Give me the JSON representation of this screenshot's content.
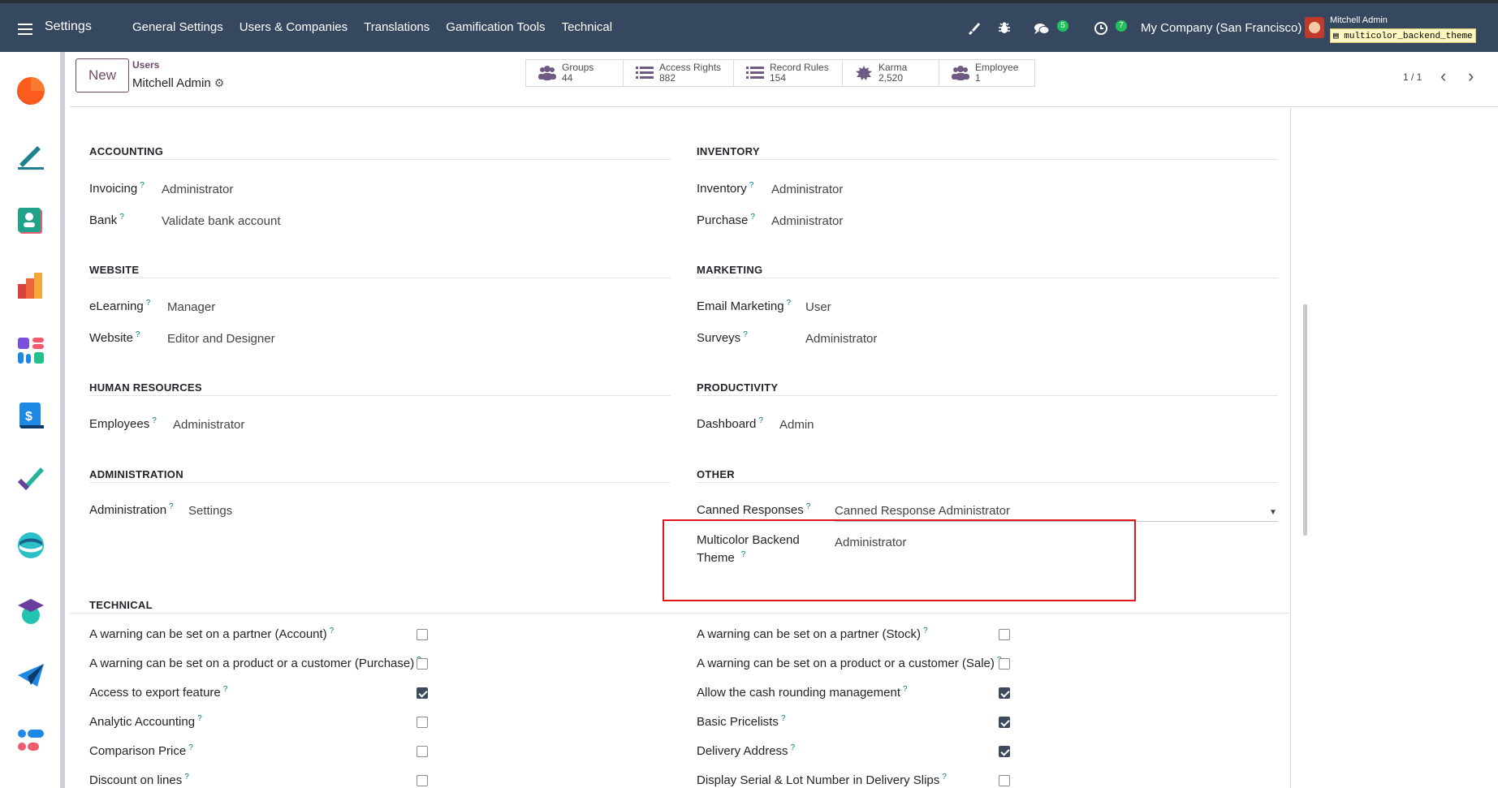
{
  "nav": {
    "app_name": "Settings",
    "menu": [
      "General Settings",
      "Users & Companies",
      "Translations",
      "Gamification Tools",
      "Technical"
    ],
    "messages_badge": "5",
    "activities_badge": "7",
    "company": "My Company (San Francisco)",
    "user_name": "Mitchell Admin",
    "db_name": "multicolor_backend_theme"
  },
  "control": {
    "new_label": "New",
    "breadcrumb_parent": "Users",
    "breadcrumb_current": "Mitchell Admin",
    "stats": [
      {
        "label": "Groups",
        "value": "44",
        "icon": "users-icon"
      },
      {
        "label": "Access Rights",
        "value": "882",
        "icon": "list-icon"
      },
      {
        "label": "Record Rules",
        "value": "154",
        "icon": "list-icon"
      },
      {
        "label": "Karma",
        "value": "2,520",
        "icon": "gear-badge-icon"
      },
      {
        "label": "Employee",
        "value": "1",
        "icon": "users-icon"
      }
    ],
    "pager": "1 / 1"
  },
  "sections": {
    "accounting": {
      "title": "ACCOUNTING",
      "fields": [
        {
          "label": "Invoicing",
          "value": "Administrator"
        },
        {
          "label": "Bank",
          "value": "Validate bank account"
        }
      ]
    },
    "inventory": {
      "title": "INVENTORY",
      "fields": [
        {
          "label": "Inventory",
          "value": "Administrator"
        },
        {
          "label": "Purchase",
          "value": "Administrator"
        }
      ]
    },
    "website": {
      "title": "WEBSITE",
      "fields": [
        {
          "label": "eLearning",
          "value": "Manager"
        },
        {
          "label": "Website",
          "value": "Editor and Designer"
        }
      ]
    },
    "marketing": {
      "title": "MARKETING",
      "fields": [
        {
          "label": "Email Marketing",
          "value": "User"
        },
        {
          "label": "Surveys",
          "value": "Administrator"
        }
      ]
    },
    "hr": {
      "title": "HUMAN RESOURCES",
      "fields": [
        {
          "label": "Employees",
          "value": "Administrator"
        }
      ]
    },
    "productivity": {
      "title": "PRODUCTIVITY",
      "fields": [
        {
          "label": "Dashboard",
          "value": "Admin"
        }
      ]
    },
    "administration": {
      "title": "ADMINISTRATION",
      "fields": [
        {
          "label": "Administration",
          "value": "Settings"
        }
      ]
    },
    "other": {
      "title": "OTHER",
      "fields": [
        {
          "label": "Canned Responses",
          "value": "Canned Response Administrator"
        },
        {
          "label_line1": "Multicolor Backend",
          "label_line2": "Theme",
          "value": "Administrator"
        }
      ]
    },
    "technical": {
      "title": "TECHNICAL",
      "left": [
        {
          "label": "A warning can be set on a partner (Account)",
          "checked": false
        },
        {
          "label": "A warning can be set on a product or a customer (Purchase)",
          "checked": false
        },
        {
          "label": "Access to export feature",
          "checked": true
        },
        {
          "label": "Analytic Accounting",
          "checked": false
        },
        {
          "label": "Comparison Price",
          "checked": false
        },
        {
          "label": "Discount on lines",
          "checked": false
        }
      ],
      "right": [
        {
          "label": "A warning can be set on a partner (Stock)",
          "checked": false
        },
        {
          "label": "A warning can be set on a product or a customer (Sale)",
          "checked": false
        },
        {
          "label": "Allow the cash rounding management",
          "checked": true
        },
        {
          "label": "Basic Pricelists",
          "checked": true
        },
        {
          "label": "Delivery Address",
          "checked": true
        },
        {
          "label": "Display Serial & Lot Number in Delivery Slips",
          "checked": false
        }
      ]
    }
  },
  "help_mark": "?",
  "colors": {
    "navbar": "#36485f",
    "accent": "#714b67",
    "highlight": "#e0161e",
    "help": "#017e84"
  }
}
